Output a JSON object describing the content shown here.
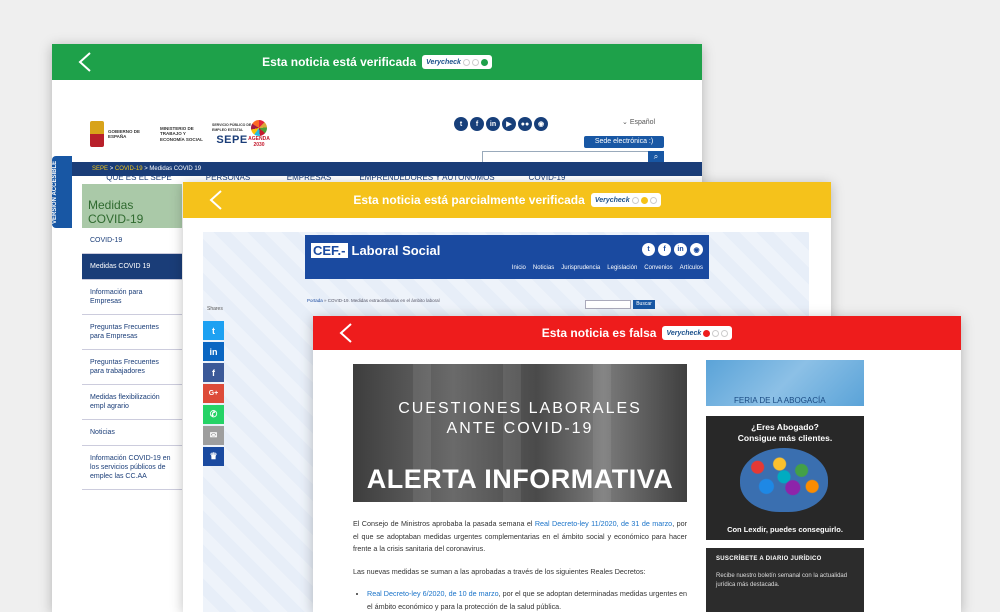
{
  "windows": {
    "sepe": {
      "banner_text": "Esta noticia está verificada",
      "banner_color": "#1ea14a",
      "badge": "Verycheck",
      "header": {
        "gob_text": "GOBIERNO DE ESPAÑA",
        "ministry_text": "MINISTERIO DE TRABAJO Y ECONOMÍA SOCIAL",
        "sepe_small": "SERVICIO PÚBLICO DE EMPLEO ESTATAL",
        "sepe_logo": "SEPE",
        "agenda": "AGENDA 2030",
        "social": [
          "t",
          "f",
          "in",
          "▶",
          "●●",
          "◉"
        ],
        "language": "Español",
        "sede_button": "Sede electrónica :)",
        "search_icon": "search-icon"
      },
      "nav": [
        "QUÉ ES EL SEPE",
        "PERSONAS",
        "EMPRESAS",
        "EMPRENDEDORES Y AUTÓNOMOS",
        "COVID-19"
      ],
      "breadcrumb": {
        "home": "SEPE",
        "sep1": ">",
        "covid": "COVID-19",
        "sep2": ">",
        "current": "Medidas COVID 19"
      },
      "accesible_label": "VERSIÓN ACCESIBLE",
      "section_title": "Medidas COVID-19",
      "side_menu": [
        "COVID-19",
        "Medidas COVID 19",
        "Información para Empresas",
        "Preguntas Frecuentes para Empresas",
        "Preguntas Frecuentes para trabajadores",
        "Medidas flexibilización empl agrario",
        "Noticias",
        "Información COVID-19 en los servicios públicos de emplec las CC.AA"
      ]
    },
    "cef": {
      "banner_text": "Esta noticia está parcialmente verificada",
      "banner_color": "#f5c21b",
      "badge": "Verycheck",
      "logo_box": "CEF.-",
      "logo_text": "Laboral Social",
      "social": [
        "t",
        "f",
        "in",
        "◉"
      ],
      "nav": [
        "Inicio",
        "Noticias",
        "Jurisprudencia",
        "Legislación",
        "Convenios",
        "Artículos"
      ],
      "breadcrumb_home": "Portada",
      "breadcrumb_rest": " » COVID-19. Medidas extraordinarias en el ámbito laboral",
      "search_button": "Buscar",
      "shares_label": "Shares",
      "share_buttons": [
        "t",
        "in",
        "f",
        "G+",
        "✆",
        "✉",
        "♛"
      ]
    },
    "diario": {
      "banner_text": "Esta noticia es falsa",
      "banner_color": "#ee1c1c",
      "badge": "Verycheck",
      "image": {
        "line1": "CUESTIONES LABORALES",
        "line2": "ANTE COVID-19",
        "line3": "ALERTA INFORMATIVA"
      },
      "paragraph1_a": "El Consejo de Ministros aprobaba la pasada semana el ",
      "paragraph1_link": "Real Decreto-ley 11/2020, de 31 de marzo",
      "paragraph1_b": ", por el que se adoptaban medidas urgentes complementarias en el ámbito social y económico para hacer frente a la crisis sanitaria del coronavirus.",
      "paragraph2": "Las nuevas medidas se suman a las aprobadas a través de los siguientes Reales Decretos:",
      "bullet_link": "Real Decreto-ley 6/2020, de 10 de marzo",
      "bullet_rest": ", por el que se adoptan determinadas medidas urgentes en el ámbito económico y para la protección de la salud pública.",
      "feria_text": "FERIA DE LA ABOGACÍA",
      "lexdir_q1": "¿Eres Abogado?",
      "lexdir_q1b": "Consigue más clientes.",
      "lexdir_q2": "Con Lexdir, puedes conseguirlo.",
      "subscribe_title": "SUSCRÍBETE A DIARIO JURÍDICO",
      "subscribe_desc": "Recibe nuestro boletín semanal con la actualidad jurídica más destacada."
    }
  }
}
